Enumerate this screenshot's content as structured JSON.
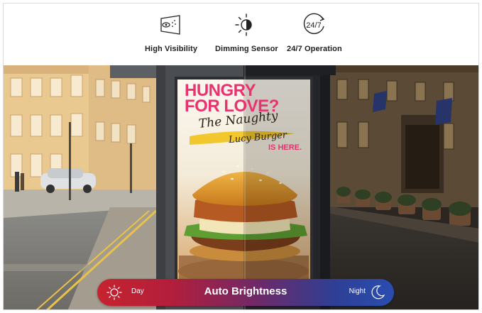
{
  "features": [
    {
      "icon": "high-visibility-icon",
      "label": "High Visibility"
    },
    {
      "icon": "dimming-sensor-icon",
      "label": "Dimming Sensor"
    },
    {
      "icon": "operation-24-7-icon",
      "label": "24/7 Operation",
      "icon_text": "24/7"
    }
  ],
  "poster": {
    "headline_1": "HUNGRY",
    "headline_2": "FOR LOVE?",
    "script_1": "The Naughty",
    "script_2": "Lucy Burger",
    "tagline": "IS HERE."
  },
  "brightness_bar": {
    "title": "Auto Brightness",
    "left_label": "Day",
    "right_label": "Night",
    "gradient_colors": [
      "#c5232f",
      "#6c2a6a",
      "#2a4db0"
    ]
  }
}
